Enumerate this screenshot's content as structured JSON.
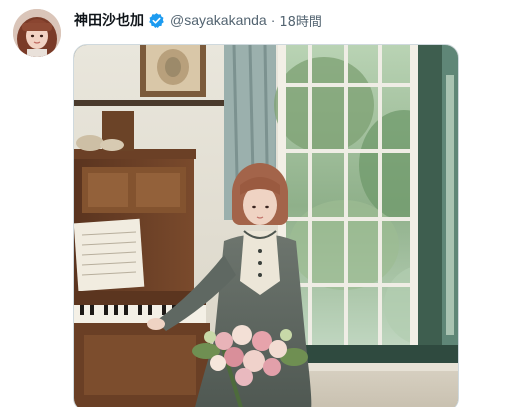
{
  "tweet": {
    "display_name": "神田沙也加",
    "verified_icon": "verified-badge-icon",
    "handle": "@sayakakanda",
    "separator": "·",
    "timestamp": "18時間"
  },
  "colors": {
    "name": "#0f1419",
    "secondary_text": "#536471",
    "verified_blue": "#1d9bf0",
    "media_border": "#cfd9de"
  }
}
